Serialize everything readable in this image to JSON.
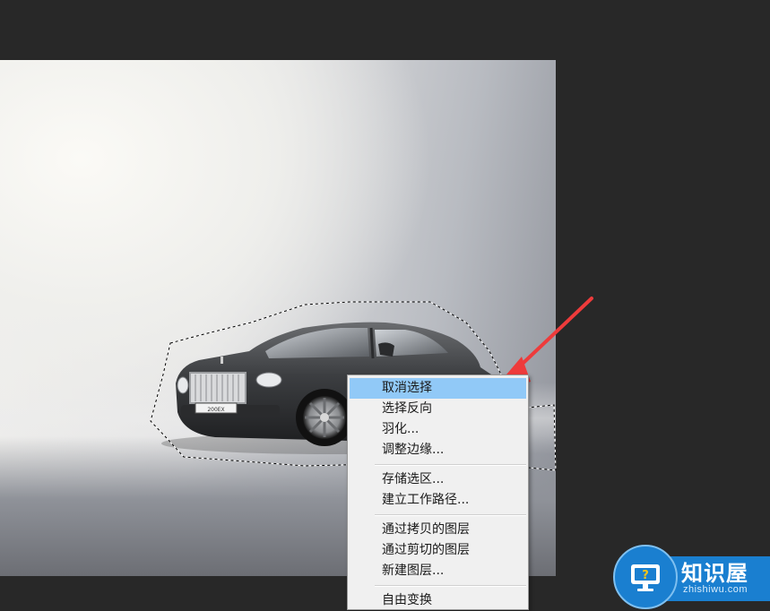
{
  "context_menu": {
    "items": [
      {
        "label": "取消选择",
        "highlighted": true
      },
      {
        "label": "选择反向"
      },
      {
        "label": "羽化..."
      },
      {
        "label": "调整边缘..."
      },
      {
        "label": "存储选区..."
      },
      {
        "label": "建立工作路径..."
      },
      {
        "label": "通过拷贝的图层"
      },
      {
        "label": "通过剪切的图层"
      },
      {
        "label": "新建图层..."
      },
      {
        "label": "自由变换"
      }
    ]
  },
  "canvas": {
    "license_plate": "200EX"
  },
  "watermark": {
    "title": "知识屋",
    "subtitle": "zhishiwu.com",
    "icon": "question-monitor-icon"
  },
  "annotation": {
    "arrow_color": "#ee3b3b"
  }
}
